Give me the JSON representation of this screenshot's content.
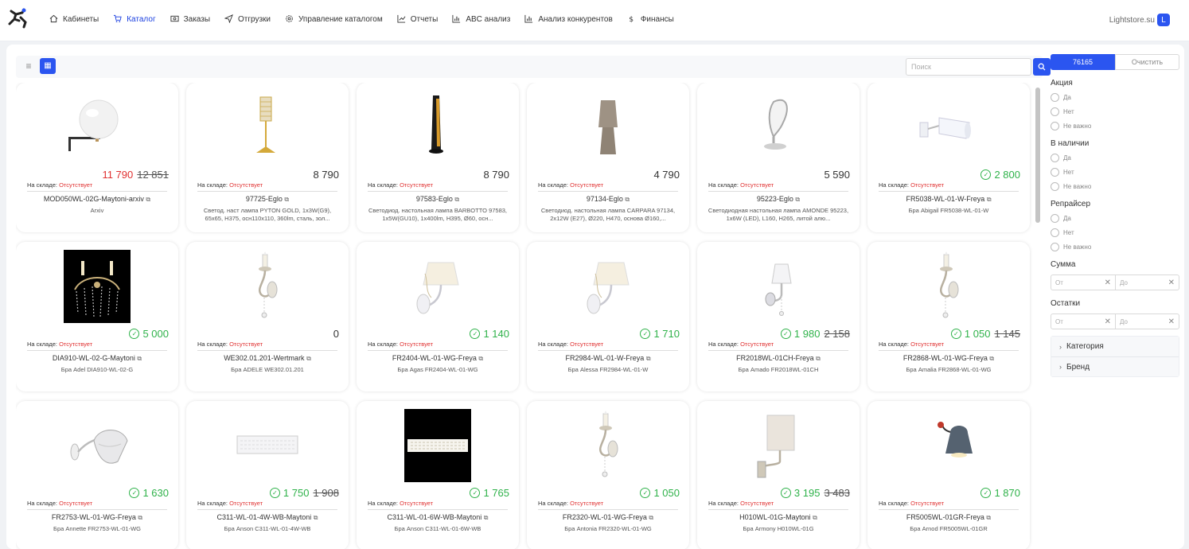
{
  "header": {
    "nav": [
      {
        "label": "Кабинеты",
        "icon": "home-icon"
      },
      {
        "label": "Каталог",
        "icon": "cart-icon",
        "active": true
      },
      {
        "label": "Заказы",
        "icon": "money-icon"
      },
      {
        "label": "Отгрузки",
        "icon": "send-icon"
      },
      {
        "label": "Управление каталогом",
        "icon": "gear-icon"
      },
      {
        "label": "Отчеты",
        "icon": "trend-icon"
      },
      {
        "label": "ABC анализ",
        "icon": "bar-chart-icon"
      },
      {
        "label": "Анализ конкурентов",
        "icon": "bar-chart-icon"
      },
      {
        "label": "Финансы",
        "icon": "dollar-icon"
      }
    ],
    "site": "Lightstore.su",
    "avatar": "L"
  },
  "toolbar": {
    "search_placeholder": "Поиск"
  },
  "sidebar": {
    "count": "76165",
    "clear": "Очистить",
    "akciya": {
      "title": "Акция",
      "options": [
        "Да",
        "Нет",
        "Не важно"
      ]
    },
    "nalichie": {
      "title": "В наличии",
      "options": [
        "Да",
        "Нет",
        "Не важно"
      ]
    },
    "repricer": {
      "title": "Репрайсер",
      "options": [
        "Да",
        "Нет",
        "Не важно"
      ]
    },
    "summa": {
      "title": "Сумма",
      "from": "От",
      "to": "До"
    },
    "ostatki": {
      "title": "Остатки",
      "from": "От",
      "to": "До"
    },
    "collapse": [
      "Категория",
      "Бренд"
    ]
  },
  "stock_label": "На складе:",
  "stock_status": "Отсутствует",
  "products": [
    {
      "price": "11 790",
      "old": "12 851",
      "sale": true,
      "green": false,
      "sku": "MOD050WL-02G-Maytoni-arxiv",
      "desc": "Arxiv",
      "img": "globe"
    },
    {
      "price": "8 790",
      "old": "",
      "sale": false,
      "green": false,
      "sku": "97725-Eglo",
      "desc": "Светод. наст лампа PYTON GOLD, 1х3W(G9), 65х65, H375, осн110х110, 360lm, сталь, зол...",
      "img": "crystal-table"
    },
    {
      "price": "8 790",
      "old": "",
      "sale": false,
      "green": false,
      "sku": "97583-Eglo",
      "desc": "Светодиод. настольная лампа BARBOTTO 97583, 1х5W(GU10), 1х400lm, H395, Ø60, осн...",
      "img": "black-cyl"
    },
    {
      "price": "4 790",
      "old": "",
      "sale": false,
      "green": false,
      "sku": "97134-Eglo",
      "desc": "Светодиод. настольная лампа CARPARA 97134, 2х12W (E27), Ø220, H470, основа Ø160,...",
      "img": "taupe-lamp"
    },
    {
      "price": "5 590",
      "old": "",
      "sale": false,
      "green": false,
      "sku": "95223-Eglo",
      "desc": "Светодиодная настольная лампа AMONDE 95223, 1х6W (LED), L160, H265, литой алю...",
      "img": "chrome-loop"
    },
    {
      "price": "2 800",
      "old": "",
      "sale": false,
      "green": true,
      "sku": "FR5038-WL-01-W-Freya",
      "desc": "Бра Abigail FR5038-WL-01-W",
      "img": "white-spot"
    },
    {
      "price": "5 000",
      "old": "",
      "sale": false,
      "green": true,
      "sku": "DIA910-WL-02-G-Maytoni",
      "desc": "Бра Adel DIA910-WL-02-G",
      "img": "crystal-black"
    },
    {
      "price": "0",
      "old": "",
      "sale": false,
      "green": false,
      "sku": "WE302.01.201-Wertmark",
      "desc": "Бра ADELE WE302.01.201",
      "img": "candle-sconce"
    },
    {
      "price": "1 140",
      "old": "",
      "sale": false,
      "green": true,
      "sku": "FR2404-WL-01-WG-Freya",
      "desc": "Бра Agas FR2404-WL-01-WG",
      "img": "shade-sconce"
    },
    {
      "price": "1 710",
      "old": "",
      "sale": false,
      "green": true,
      "sku": "FR2984-WL-01-W-Freya",
      "desc": "Бра Alessa FR2984-WL-01-W",
      "img": "shade-sconce"
    },
    {
      "price": "1 980",
      "old": "2 158",
      "sale": true,
      "green": true,
      "sku": "FR2018WL-01CH-Freya",
      "desc": "Бра Amado FR2018WL-01CH",
      "img": "small-sconce"
    },
    {
      "price": "1 050",
      "old": "1 145",
      "sale": true,
      "green": true,
      "sku": "FR2868-WL-01-WG-Freya",
      "desc": "Бра Amalia FR2868-WL-01-WG",
      "img": "candle-sconce"
    },
    {
      "price": "1 630",
      "old": "",
      "sale": false,
      "green": true,
      "sku": "FR2753-WL-01-WG-Freya",
      "desc": "Бра Annette FR2753-WL-01-WG",
      "img": "dome-sconce"
    },
    {
      "price": "1 750",
      "old": "1 908",
      "sale": true,
      "green": true,
      "sku": "C311-WL-01-4W-WB-Maytoni",
      "desc": "Бра Anson C311-WL-01-4W-WB",
      "img": "bar-light"
    },
    {
      "price": "1 765",
      "old": "",
      "sale": false,
      "green": true,
      "sku": "C311-WL-01-6W-WB-Maytoni",
      "desc": "Бра Anson C311-WL-01-6W-WB",
      "img": "bar-black"
    },
    {
      "price": "1 050",
      "old": "",
      "sale": false,
      "green": true,
      "sku": "FR2320-WL-01-WG-Freya",
      "desc": "Бра Antonia FR2320-WL-01-WG",
      "img": "candle-sconce"
    },
    {
      "price": "3 195",
      "old": "3 483",
      "sale": true,
      "green": true,
      "sku": "H010WL-01G-Maytoni",
      "desc": "Бра Armony H010WL-01G",
      "img": "cyl-sconce"
    },
    {
      "price": "1 870",
      "old": "",
      "sale": false,
      "green": true,
      "sku": "FR5005WL-01GR-Freya",
      "desc": "Бра Arnod FR5005WL-01GR",
      "img": "grey-dome"
    }
  ]
}
